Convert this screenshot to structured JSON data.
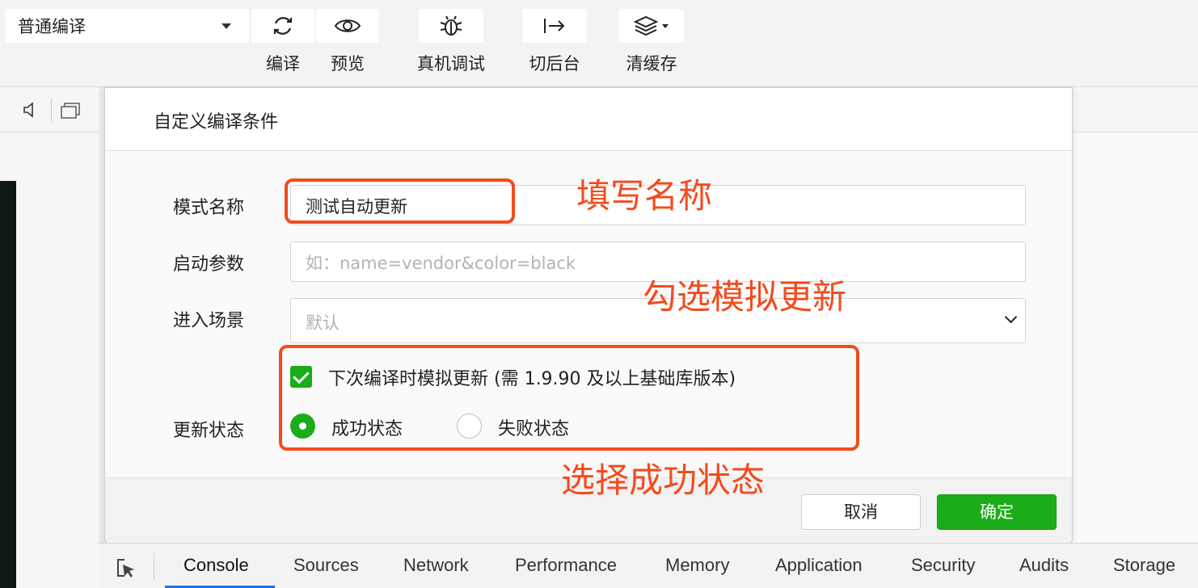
{
  "toolbar": {
    "mode_value": "普通编译",
    "buttons": {
      "compile": "编译",
      "preview": "预览",
      "remote_debug": "真机调试",
      "background": "切后台",
      "clear_cache": "清缓存"
    }
  },
  "dialog": {
    "title": "自定义编译条件",
    "mode_name": {
      "label": "模式名称",
      "value": "测试自动更新"
    },
    "launch_params": {
      "label": "启动参数",
      "placeholder": "如：name=vendor&color=black"
    },
    "scene": {
      "label": "进入场景",
      "value": "默认"
    },
    "update": {
      "checkbox_label": "下次编译时模拟更新 (需 1.9.90 及以上基础库版本)",
      "checked": true,
      "status_label": "更新状态",
      "options": [
        "成功状态",
        "失败状态"
      ],
      "selected": "成功状态"
    },
    "cancel_label": "取消",
    "ok_label": "确定"
  },
  "annotations": {
    "fill_name": "填写名称",
    "check_update": "勾选模拟更新",
    "choose_success": "选择成功状态"
  },
  "devtools_tabs": [
    "Console",
    "Sources",
    "Network",
    "Performance",
    "Memory",
    "Application",
    "Security",
    "Audits",
    "Storage"
  ],
  "active_tab": "Console",
  "colors": {
    "accent": "#1aad19",
    "annotation": "#f24b1d",
    "tab_active": "#1a73e8"
  }
}
